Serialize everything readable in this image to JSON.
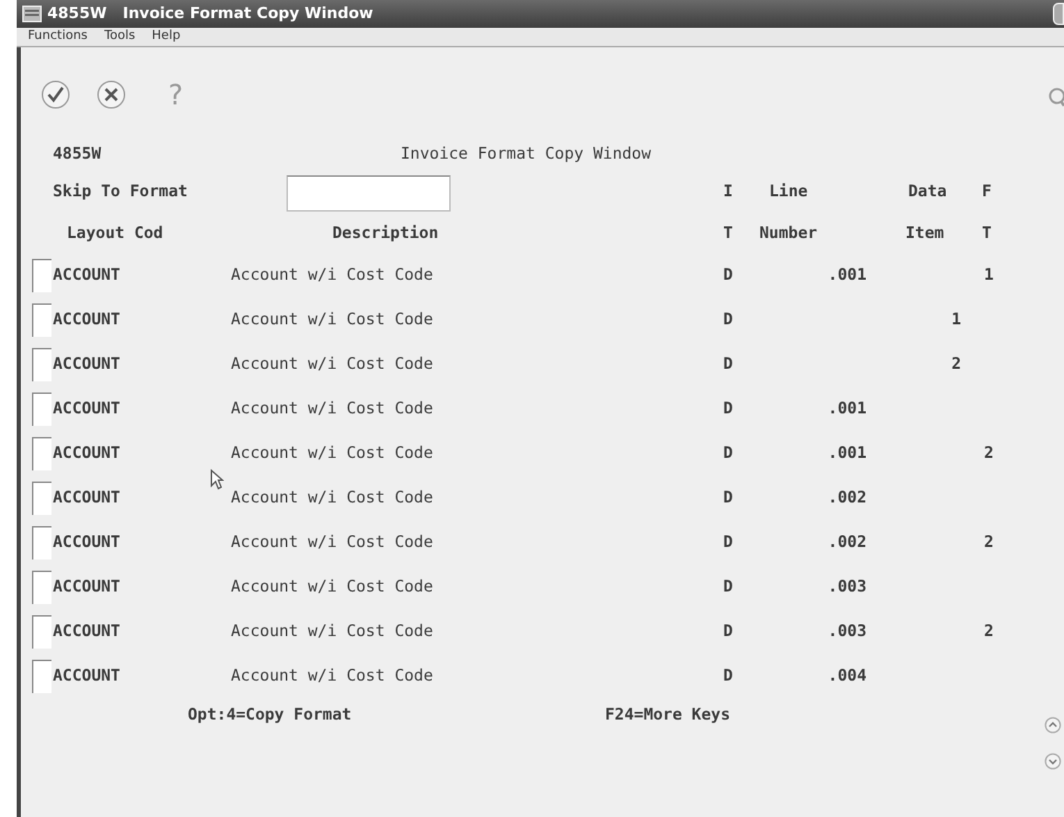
{
  "window": {
    "title": "4855W   Invoice Format Copy Window"
  },
  "menu": [
    "Functions",
    "Tools",
    "Help"
  ],
  "toolbar": {
    "help_glyph": "?"
  },
  "form": {
    "id": "4855W",
    "title": "Invoice Format Copy Window"
  },
  "skip_to_format": {
    "label": "Skip To Format"
  },
  "columns": [
    {
      "line2": "Layout Cod"
    },
    {
      "line2": "Description"
    },
    {
      "line1": "I",
      "line2": "T"
    },
    {
      "line1": "Line",
      "line2": "Number"
    },
    {
      "line1": "Data",
      "line2": "Item"
    },
    {
      "line1": "F",
      "line2": "T"
    }
  ],
  "rows": [
    {
      "layout_code": "ACCOUNT",
      "description": "Account w/i Cost Code",
      "it": "D",
      "line_number": ".001",
      "ft": "1"
    },
    {
      "layout_code": "ACCOUNT",
      "description": "Account w/i Cost Code",
      "it": "D",
      "data_item": "1"
    },
    {
      "layout_code": "ACCOUNT",
      "description": "Account w/i Cost Code",
      "it": "D",
      "data_item": "2"
    },
    {
      "layout_code": "ACCOUNT",
      "description": "Account w/i Cost Code",
      "it": "D",
      "line_number": ".001"
    },
    {
      "layout_code": "ACCOUNT",
      "description": "Account w/i Cost Code",
      "it": "D",
      "line_number": ".001",
      "ft": "2"
    },
    {
      "layout_code": "ACCOUNT",
      "description": "Account w/i Cost Code",
      "it": "D",
      "line_number": ".002"
    },
    {
      "layout_code": "ACCOUNT",
      "description": "Account w/i Cost Code",
      "it": "D",
      "line_number": ".002",
      "ft": "2"
    },
    {
      "layout_code": "ACCOUNT",
      "description": "Account w/i Cost Code",
      "it": "D",
      "line_number": ".003"
    },
    {
      "layout_code": "ACCOUNT",
      "description": "Account w/i Cost Code",
      "it": "D",
      "line_number": ".003",
      "ft": "2"
    },
    {
      "layout_code": "ACCOUNT",
      "description": "Account w/i Cost Code",
      "it": "D",
      "line_number": ".004"
    }
  ],
  "footer": [
    "Opt:4=Copy Format",
    "F24=More Keys"
  ]
}
